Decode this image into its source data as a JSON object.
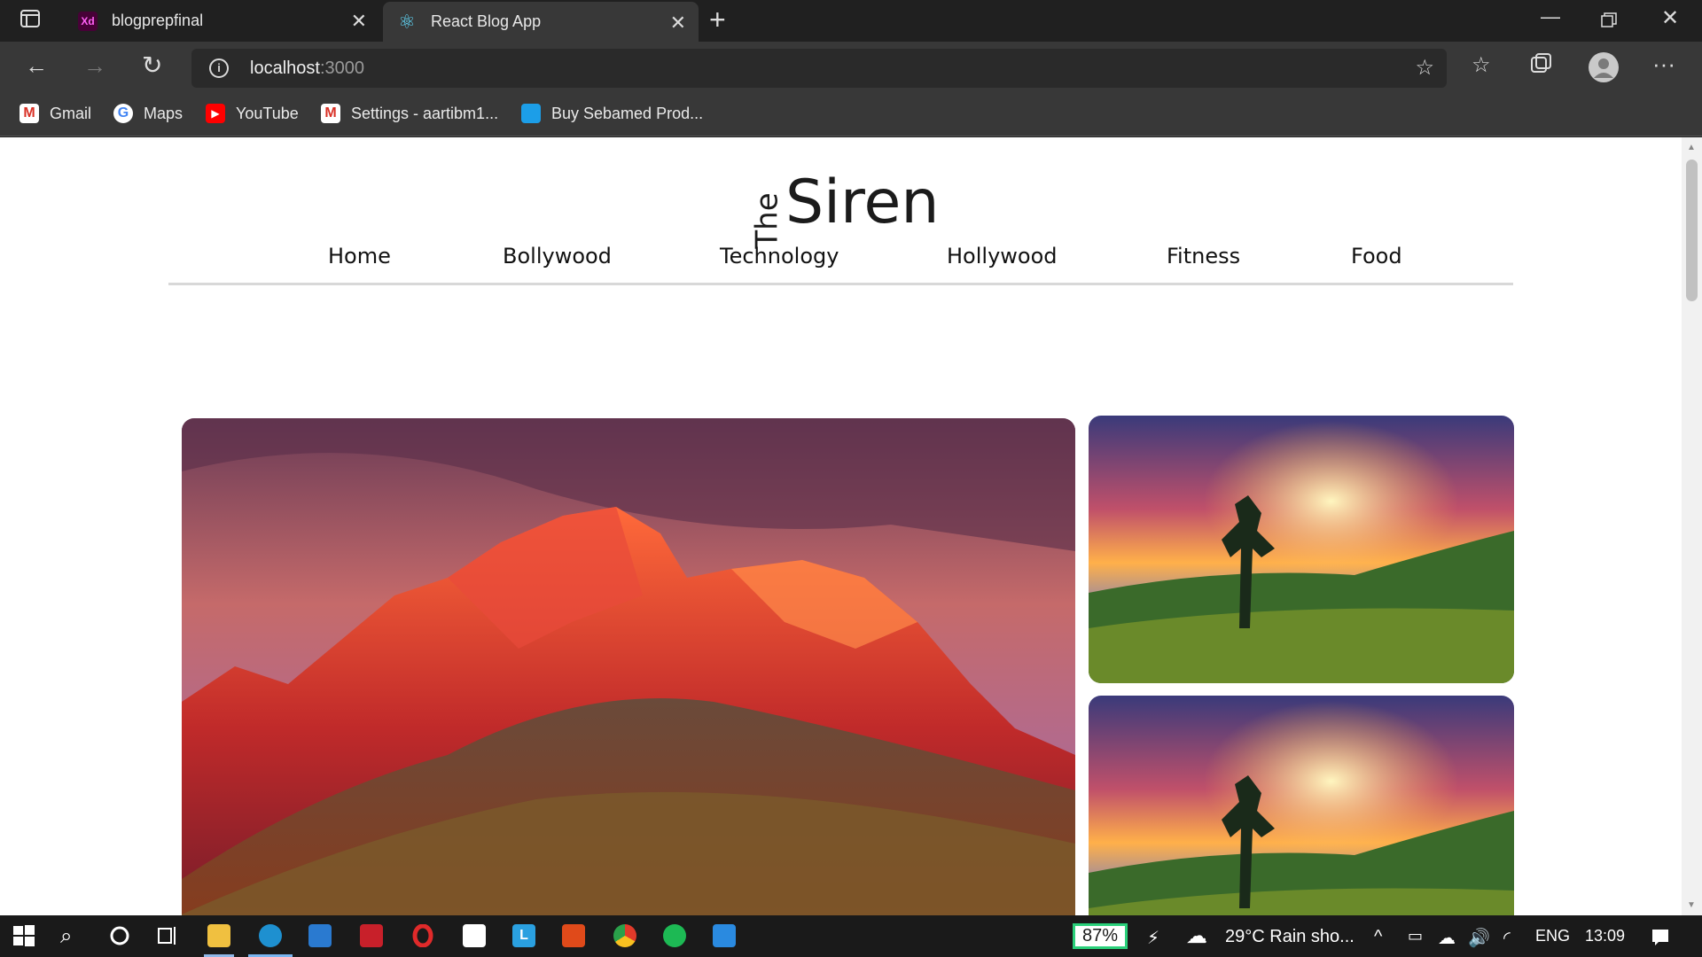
{
  "browser": {
    "tabs": [
      {
        "title": "blogprepfinal",
        "icon": "adobe-xd-icon"
      },
      {
        "title": "React Blog App",
        "icon": "react-icon"
      }
    ],
    "new_tab_symbol": "+",
    "address": {
      "host": "localhost",
      "port": ":3000"
    },
    "bookmarks": [
      {
        "label": "Gmail",
        "icon": "gmail-icon"
      },
      {
        "label": "Maps",
        "icon": "google-icon"
      },
      {
        "label": "YouTube",
        "icon": "youtube-icon"
      },
      {
        "label": "Settings - aartibm1...",
        "icon": "gmail-icon"
      },
      {
        "label": "Buy Sebamed Prod...",
        "icon": "store-icon"
      }
    ]
  },
  "site": {
    "logo_small": "The",
    "logo_big": "Siren",
    "nav": [
      "Home",
      "Bollywood",
      "Technology",
      "Hollywood",
      "Fitness",
      "Food"
    ]
  },
  "taskbar": {
    "battery": "87%",
    "weather": "29°C  Rain sho...",
    "language": "ENG",
    "time": "13:09"
  }
}
